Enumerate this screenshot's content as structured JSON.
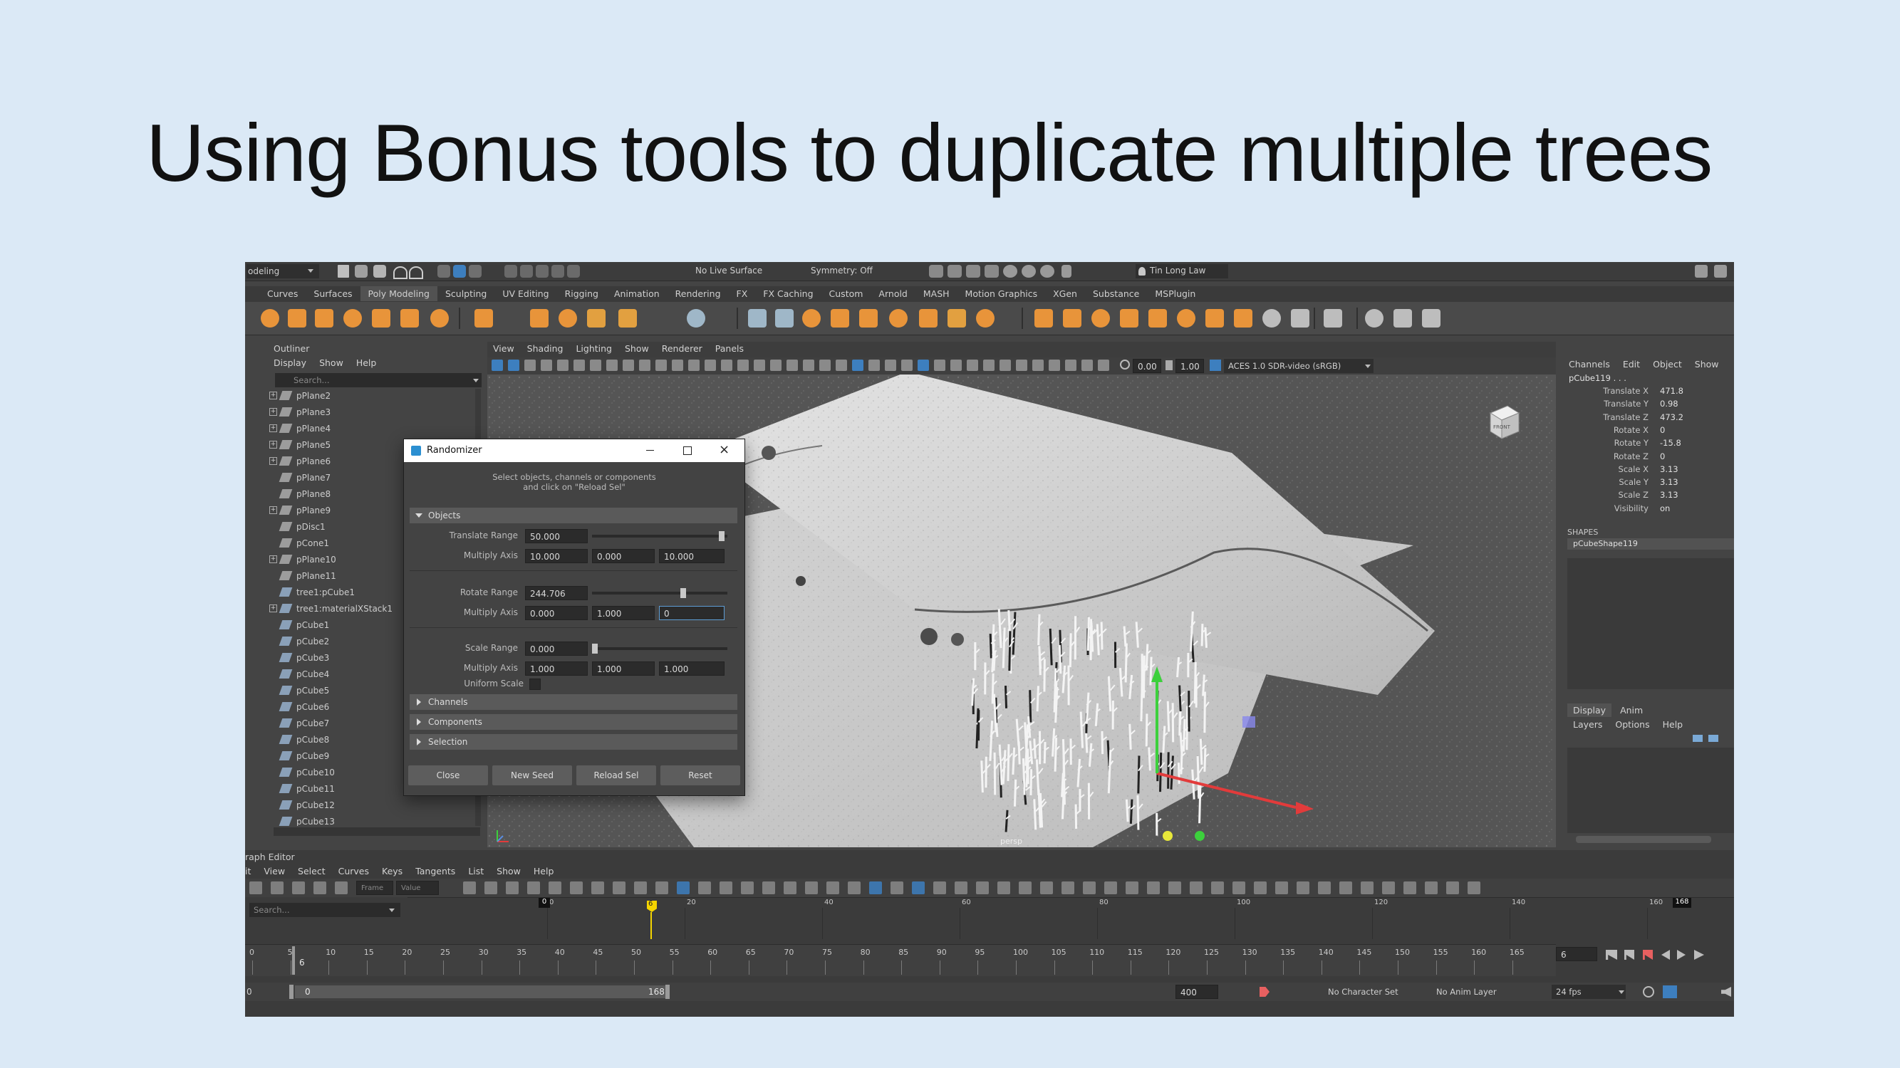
{
  "slide": {
    "title": "Using Bonus tools to duplicate multiple trees"
  },
  "statusline": {
    "menuset": "odeling",
    "live_surface": "No Live Surface",
    "symmetry": "Symmetry: Off",
    "user": "Tin Long Law"
  },
  "shelf_tabs": [
    "Curves",
    "Surfaces",
    "Poly Modeling",
    "Sculpting",
    "UV Editing",
    "Rigging",
    "Animation",
    "Rendering",
    "FX",
    "FX Caching",
    "Custom",
    "Arnold",
    "MASH",
    "Motion Graphics",
    "XGen",
    "Substance",
    "MSPlugin"
  ],
  "shelf_active": "Poly Modeling",
  "outliner": {
    "title": "Outliner",
    "menu": [
      "Display",
      "Show",
      "Help"
    ],
    "search_placeholder": "Search...",
    "items": [
      "pPlane2",
      "pPlane3",
      "pPlane4",
      "pPlane5",
      "pPlane6",
      "pPlane7",
      "pPlane8",
      "pPlane9",
      "pDisc1",
      "pCone1",
      "pPlane10",
      "pPlane11",
      "tree1:pCube1",
      "tree1:materialXStack1",
      "pCube1",
      "pCube2",
      "pCube3",
      "pCube4",
      "pCube5",
      "pCube6",
      "pCube7",
      "pCube8",
      "pCube9",
      "pCube10",
      "pCube11",
      "pCube12",
      "pCube13"
    ]
  },
  "viewport": {
    "menu": [
      "View",
      "Shading",
      "Lighting",
      "Show",
      "Renderer",
      "Panels"
    ],
    "exposure": "0.00",
    "gamma": "1.00",
    "color_space": "ACES 1.0 SDR-video (sRGB)",
    "camera_label": "persp",
    "viewcube_label": "FRONT"
  },
  "randomizer": {
    "title": "Randomizer",
    "instructions_1": "Select objects, channels or components",
    "instructions_2": "and click on \"Reload Sel\"",
    "sections": {
      "objects": "Objects",
      "channels": "Channels",
      "components": "Components",
      "selection": "Selection"
    },
    "translate_range_label": "Translate Range",
    "translate_range": "50.000",
    "translate_range_fraction": 0.98,
    "multiply_axis_label": "Multiply Axis",
    "translate_axis": [
      "10.000",
      "0.000",
      "10.000"
    ],
    "rotate_range_label": "Rotate Range",
    "rotate_range": "244.706",
    "rotate_range_fraction": 0.68,
    "rotate_axis": [
      "0.000",
      "1.000",
      "0"
    ],
    "scale_range_label": "Scale Range",
    "scale_range": "0.000",
    "scale_range_fraction": 0.0,
    "scale_axis": [
      "1.000",
      "1.000",
      "1.000"
    ],
    "uniform_scale_label": "Uniform Scale",
    "buttons": {
      "close": "Close",
      "new_seed": "New Seed",
      "reload_sel": "Reload Sel",
      "reset": "Reset"
    }
  },
  "channel_box": {
    "menu": [
      "Channels",
      "Edit",
      "Object",
      "Show"
    ],
    "object": "pCube119 . . .",
    "channels": [
      {
        "label": "Translate X",
        "value": "471.8"
      },
      {
        "label": "Translate Y",
        "value": "0.98"
      },
      {
        "label": "Translate Z",
        "value": "473.2"
      },
      {
        "label": "Rotate X",
        "value": "0"
      },
      {
        "label": "Rotate Y",
        "value": "-15.8"
      },
      {
        "label": "Rotate Z",
        "value": "0"
      },
      {
        "label": "Scale X",
        "value": "3.13"
      },
      {
        "label": "Scale Y",
        "value": "3.13"
      },
      {
        "label": "Scale Z",
        "value": "3.13"
      },
      {
        "label": "Visibility",
        "value": "on"
      }
    ],
    "shapes_label": "SHAPES",
    "shape": "pCubeShape119",
    "layer_tabs": [
      "Display",
      "Anim"
    ],
    "layer_menu": [
      "Layers",
      "Options",
      "Help"
    ]
  },
  "graph_editor": {
    "title": "raph Editor",
    "menu": [
      "it",
      "View",
      "Select",
      "Curves",
      "Keys",
      "Tangents",
      "List",
      "Show",
      "Help"
    ],
    "frame_label": "Frame",
    "value_label": "Value",
    "search_placeholder": "Search...",
    "graph_ticks": [
      "0",
      "20",
      "40",
      "60",
      "80",
      "100",
      "120",
      "140",
      "160"
    ],
    "graph_start_frame": "0",
    "graph_current_frame": "6",
    "graph_end_frame": "168"
  },
  "timeline": {
    "ticks": [
      "0",
      "5",
      "10",
      "15",
      "20",
      "25",
      "30",
      "35",
      "40",
      "45",
      "50",
      "55",
      "60",
      "65",
      "70",
      "75",
      "80",
      "85",
      "90",
      "95",
      "100",
      "105",
      "110",
      "115",
      "120",
      "125",
      "130",
      "135",
      "140",
      "145",
      "150",
      "155",
      "160",
      "165"
    ],
    "current_frame": "6",
    "current_field": "6",
    "range_start_outer": "0",
    "range_start": "0",
    "range_end": "168",
    "range_end_outer": "400",
    "character_set": "No Character Set",
    "anim_layer": "No Anim Layer",
    "fps": "24 fps"
  },
  "colors": {
    "accent": "#e8943a",
    "selected": "#5e9ed6",
    "water": "#8fbfc2",
    "timeline_marker": "#f5d500"
  }
}
